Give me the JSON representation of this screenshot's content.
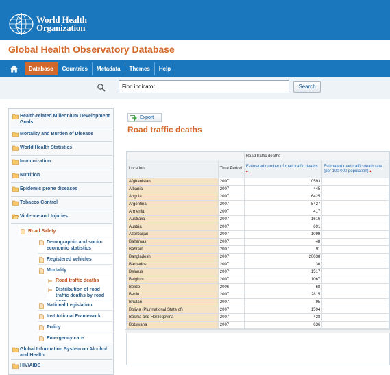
{
  "header": {
    "logo_line1": "World Health",
    "logo_line2": "Organization",
    "app_title": "Global Health Observatory Database"
  },
  "nav": {
    "items": [
      {
        "label": "Database",
        "active": true
      },
      {
        "label": "Countries",
        "active": false
      },
      {
        "label": "Metadata",
        "active": false
      },
      {
        "label": "Themes",
        "active": false
      },
      {
        "label": "Help",
        "active": false
      }
    ]
  },
  "search": {
    "value": "Find indicator",
    "button_label": "Search"
  },
  "sidebar": {
    "items": [
      {
        "label": "Health-related Millennium Development Goals"
      },
      {
        "label": "Mortality and Burden of Disease"
      },
      {
        "label": "World Health Statistics"
      },
      {
        "label": "Immunization"
      },
      {
        "label": "Nutrition"
      },
      {
        "label": "Epidemic prone diseases"
      },
      {
        "label": "Tobacco Control"
      },
      {
        "label": "Violence and Injuries"
      },
      {
        "label": "Road Safety"
      },
      {
        "label": "Demographic and socio-economic statistics"
      },
      {
        "label": "Registered vehicles"
      },
      {
        "label": "Mortality"
      },
      {
        "label": "Road traffic deaths"
      },
      {
        "label": "Distribution of road traffic deaths by road user"
      },
      {
        "label": "National Legislation"
      },
      {
        "label": "Institutional Framework"
      },
      {
        "label": "Policy"
      },
      {
        "label": "Emergency care"
      },
      {
        "label": "Global Information System on Alcohol and Health"
      },
      {
        "label": "HIV/AIDS"
      }
    ]
  },
  "main": {
    "export_label": "Export",
    "title": "Road traffic deaths",
    "table": {
      "group_header": "Road traffic deaths",
      "col_location": "Location",
      "col_time": "Time Period",
      "col_deaths": "Estimated number of road traffic deaths",
      "col_rate": "Estimated road traffic death rate (per 100 000 population)",
      "rows": [
        {
          "location": "Afghanistan",
          "year": "2007",
          "deaths": "10593"
        },
        {
          "location": "Albania",
          "year": "2007",
          "deaths": "445"
        },
        {
          "location": "Angola",
          "year": "2007",
          "deaths": "6425"
        },
        {
          "location": "Argentina",
          "year": "2007",
          "deaths": "5427"
        },
        {
          "location": "Armenia",
          "year": "2007",
          "deaths": "417"
        },
        {
          "location": "Australia",
          "year": "2007",
          "deaths": "1616"
        },
        {
          "location": "Austria",
          "year": "2007",
          "deaths": "691"
        },
        {
          "location": "Azerbaijan",
          "year": "2007",
          "deaths": "1099"
        },
        {
          "location": "Bahamas",
          "year": "2007",
          "deaths": "48"
        },
        {
          "location": "Bahrain",
          "year": "2007",
          "deaths": "91"
        },
        {
          "location": "Bangladesh",
          "year": "2007",
          "deaths": "20038"
        },
        {
          "location": "Barbados",
          "year": "2007",
          "deaths": "36"
        },
        {
          "location": "Belarus",
          "year": "2007",
          "deaths": "1517"
        },
        {
          "location": "Belgium",
          "year": "2007",
          "deaths": "1067"
        },
        {
          "location": "Belize",
          "year": "2006",
          "deaths": "68"
        },
        {
          "location": "Benin",
          "year": "2007",
          "deaths": "2815"
        },
        {
          "location": "Bhutan",
          "year": "2007",
          "deaths": "95"
        },
        {
          "location": "Bolivia (Plurinational State of)",
          "year": "2007",
          "deaths": "1594"
        },
        {
          "location": "Bosnia and Herzegovina",
          "year": "2007",
          "deaths": "428"
        },
        {
          "location": "Botswana",
          "year": "2007",
          "deaths": "636"
        }
      ]
    }
  }
}
